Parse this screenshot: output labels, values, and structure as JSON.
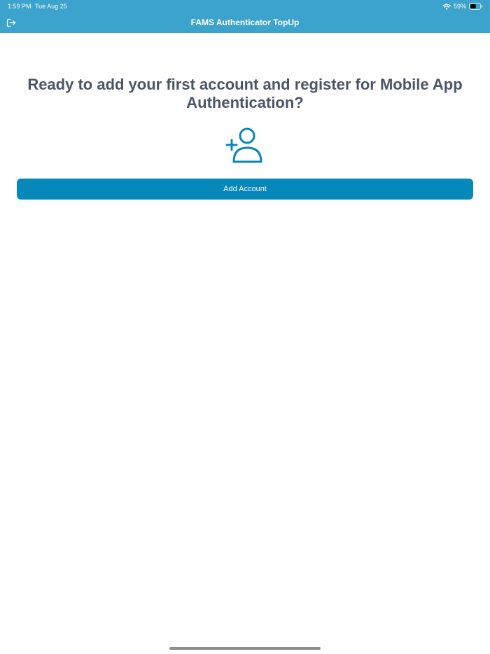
{
  "status_bar": {
    "time": "1:59 PM",
    "date": "Tue Aug 25",
    "battery": "59%",
    "battery_level": 0.59,
    "icons": {
      "wifi": "wifi-icon",
      "battery": "battery-icon"
    }
  },
  "header": {
    "title": "FAMS Authenticator TopUp",
    "logout_icon": "logout-icon",
    "background_color": "#3ca3cc"
  },
  "main": {
    "heading": "Ready to add your first account and register for Mobile App Authentication?",
    "illustration_icon": "add-user-icon",
    "add_account_label": "Add Account",
    "accent_color": "#0788ba",
    "heading_color": "#4b5568"
  }
}
